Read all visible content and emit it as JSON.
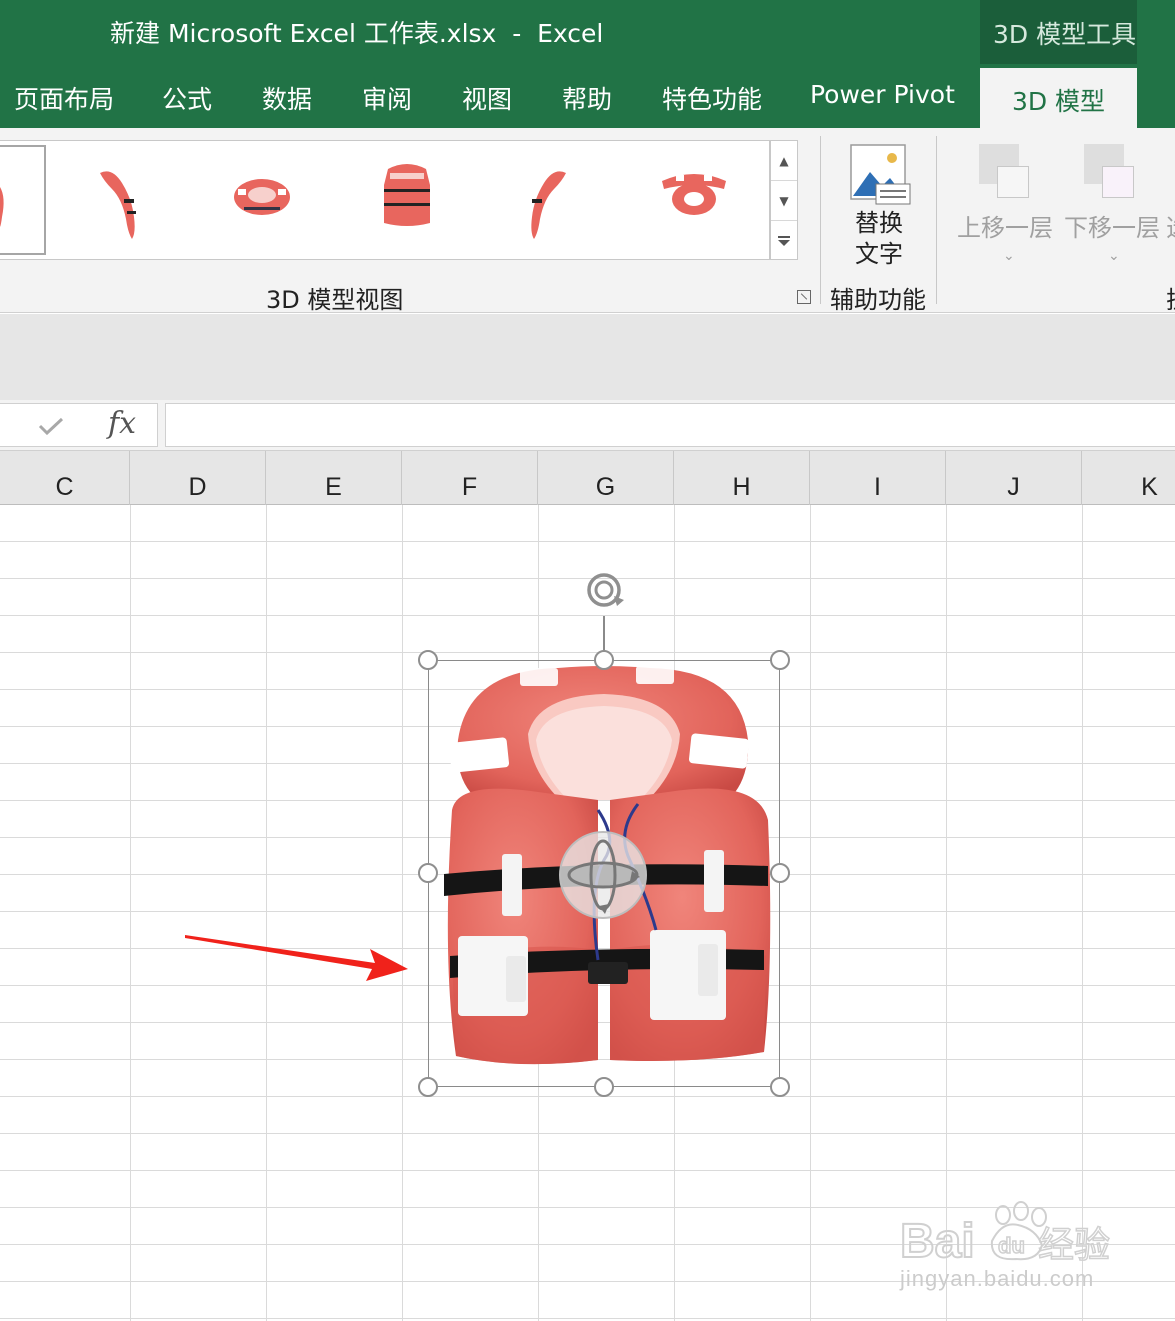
{
  "titlebar": {
    "title": "新建 Microsoft Excel 工作表.xlsx  -  Excel",
    "context_group": "3D 模型工具"
  },
  "tabs": [
    {
      "label": "页面布局"
    },
    {
      "label": "公式"
    },
    {
      "label": "数据"
    },
    {
      "label": "审阅"
    },
    {
      "label": "视图"
    },
    {
      "label": "帮助"
    },
    {
      "label": "特色功能"
    },
    {
      "label": "Power Pivot"
    }
  ],
  "active_tab": "3D 模型",
  "ribbon": {
    "views_group_label": "3D 模型视图",
    "accessibility_group_label": "辅助功能",
    "alt_text_label": "替换\n文字",
    "bring_forward_label": "上移一层",
    "send_backward_label": "下移一层",
    "next_group_cut": "挂",
    "next_button_cut": "选"
  },
  "columns": [
    "C",
    "D",
    "E",
    "F",
    "G",
    "H",
    "I",
    "J",
    "K"
  ],
  "colors": {
    "excel_green": "#217346",
    "life_jacket": "#e8665e",
    "arrow": "#f0221b"
  },
  "icons": {
    "check": "check-icon",
    "fx": "fx-icon",
    "rotate": "rotate-icon",
    "orbit": "orbit-icon"
  },
  "fx_text": "fx",
  "watermark": {
    "brand": "Bai",
    "brand2": "du",
    "brand3": "经验",
    "url": "jingyan.baidu.com"
  }
}
